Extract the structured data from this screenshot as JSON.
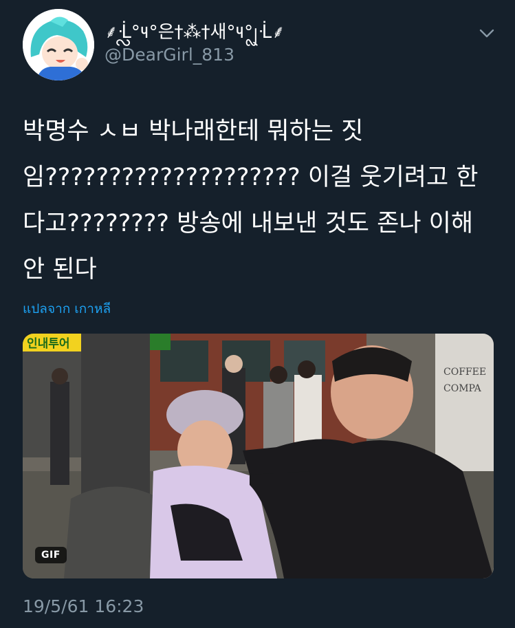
{
  "tweet": {
    "author": {
      "display_name": "⸙ᒸᩖ°౺°은†⁂†새°౺°ᩗᒸ⸙",
      "handle": "@DearGirl_813",
      "avatar_icon": "anime-character-avatar"
    },
    "menu_icon": "chevron-down-icon",
    "text": "박명수 ㅅㅂ 박나래한테 뭐하는 짓임???????????????????? 이걸 웃기려고 한다고???????? 방송에 내보낸 것도 존나 이해 안 된다",
    "translate_link": "แปลจาก เกาหลี",
    "media": {
      "badge": "GIF",
      "caption_left": "인내투어",
      "sign_text_1": "COFFEE",
      "sign_text_2": "COMPA"
    },
    "timestamp": "19/5/61 16:23"
  },
  "colors": {
    "background": "#15202b",
    "primary_text": "#ffffff",
    "secondary_text": "#8899a6",
    "link": "#1da1f2"
  }
}
